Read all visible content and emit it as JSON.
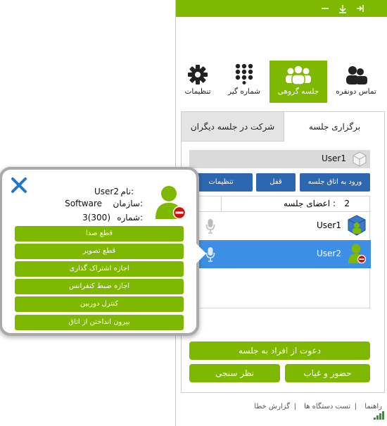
{
  "nav": {
    "tabs": [
      {
        "label": "تماس دونفره",
        "icon": "two-users-icon"
      },
      {
        "label": "جلسه گروهی",
        "icon": "group-icon"
      },
      {
        "label": "شماره گیر",
        "icon": "dialpad-icon"
      },
      {
        "label": "تنظیمات",
        "icon": "gear-icon"
      }
    ],
    "active": "جلسه گروهی"
  },
  "panel": {
    "tabs": [
      {
        "label": "برگزاری جلسه"
      },
      {
        "label": "شرکت در جلسه دیگران"
      }
    ],
    "session_name": "User1",
    "buttons": {
      "enter_room": "ورود به اتاق جلسه",
      "lock": "قفل",
      "settings": "تنظیمات"
    },
    "members": {
      "header_label": "اعضای جلسه :",
      "count": "2",
      "rows": [
        {
          "name": "User1"
        },
        {
          "name": "User2"
        }
      ]
    },
    "invite_button": "دعوت از افراد به جلسه",
    "attendance_button": "حضور و غیاب",
    "poll_button": "نظر سنجی"
  },
  "footer": {
    "help": "راهنما",
    "device_test": "تست دستگاه ها",
    "bug_report": "گزارش خطا",
    "sep": "|"
  },
  "popup": {
    "name_label": "نام:",
    "name_value": "User2",
    "org_label": "سازمان:",
    "org_value": "Software",
    "number_label": "شماره:",
    "number_value": "3(300)",
    "actions": [
      "قطع صدا",
      "قطع تصویر",
      "اجازه اشتراک گذاری",
      "اجازه ضبط کنفرانس",
      "کنترل دوربین",
      "بیرون انداختن از اتاق"
    ]
  },
  "colors": {
    "accent_green": "#7fb800",
    "button_blue": "#2d67b0",
    "selected_blue": "#3d8fe6",
    "close_blue": "#2277cc",
    "status_red": "#cc1111"
  }
}
